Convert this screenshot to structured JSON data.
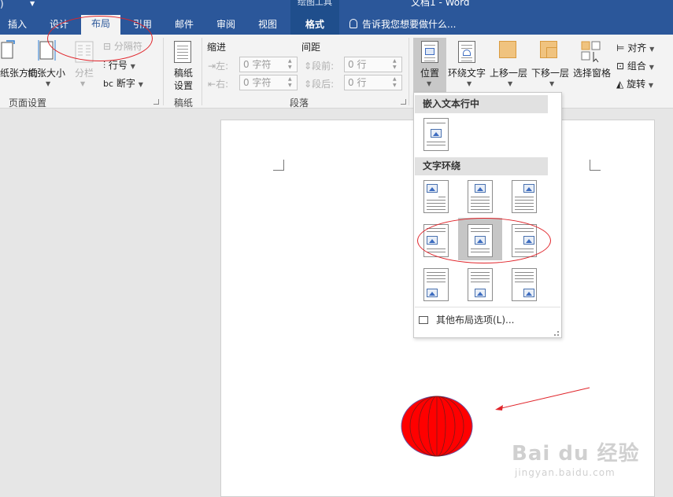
{
  "window": {
    "doc_title": "文档1 - Word",
    "context_title": "绘图工具"
  },
  "tabs": [
    {
      "label": "插入"
    },
    {
      "label": "设计"
    },
    {
      "label": "布局"
    },
    {
      "label": "引用"
    },
    {
      "label": "邮件"
    },
    {
      "label": "审阅"
    },
    {
      "label": "视图"
    },
    {
      "label": "格式"
    }
  ],
  "tell_me": "告诉我您想要做什么...",
  "ribbon": {
    "page_setup": {
      "orientation": "纸张方向",
      "size": "纸张大小",
      "columns": "分栏",
      "breaks": "分隔符",
      "line_numbers": "行号",
      "hyphenation": "断字",
      "label": "页面设置"
    },
    "manuscript": {
      "button": [
        "稿纸",
        "设置"
      ],
      "label": "稿纸"
    },
    "paragraph": {
      "indent_label": "缩进",
      "spacing_label": "间距",
      "left_label": "左:",
      "right_label": "右:",
      "before_label": "段前:",
      "after_label": "段后:",
      "left_value": "0 字符",
      "right_value": "0 字符",
      "before_value": "0 行",
      "after_value": "0 行",
      "label": "段落"
    },
    "arrange": {
      "position": "位置",
      "wrap_text": "环绕文字",
      "bring_forward": "上移一层",
      "send_backward": "下移一层",
      "selection_pane": "选择窗格",
      "align": "对齐",
      "group": "组合",
      "rotate": "旋转"
    }
  },
  "dropdown": {
    "inline_header": "嵌入文本行中",
    "wrap_header": "文字环绕",
    "more_options": "其他布局选项(L)..."
  },
  "watermark": {
    "main": "Bai du 经验",
    "sub": "jingyan.baidu.com"
  },
  "colors": {
    "ribbon_blue": "#2b579a",
    "annotation_red": "#e0242a",
    "shape_red": "#ff0000"
  }
}
